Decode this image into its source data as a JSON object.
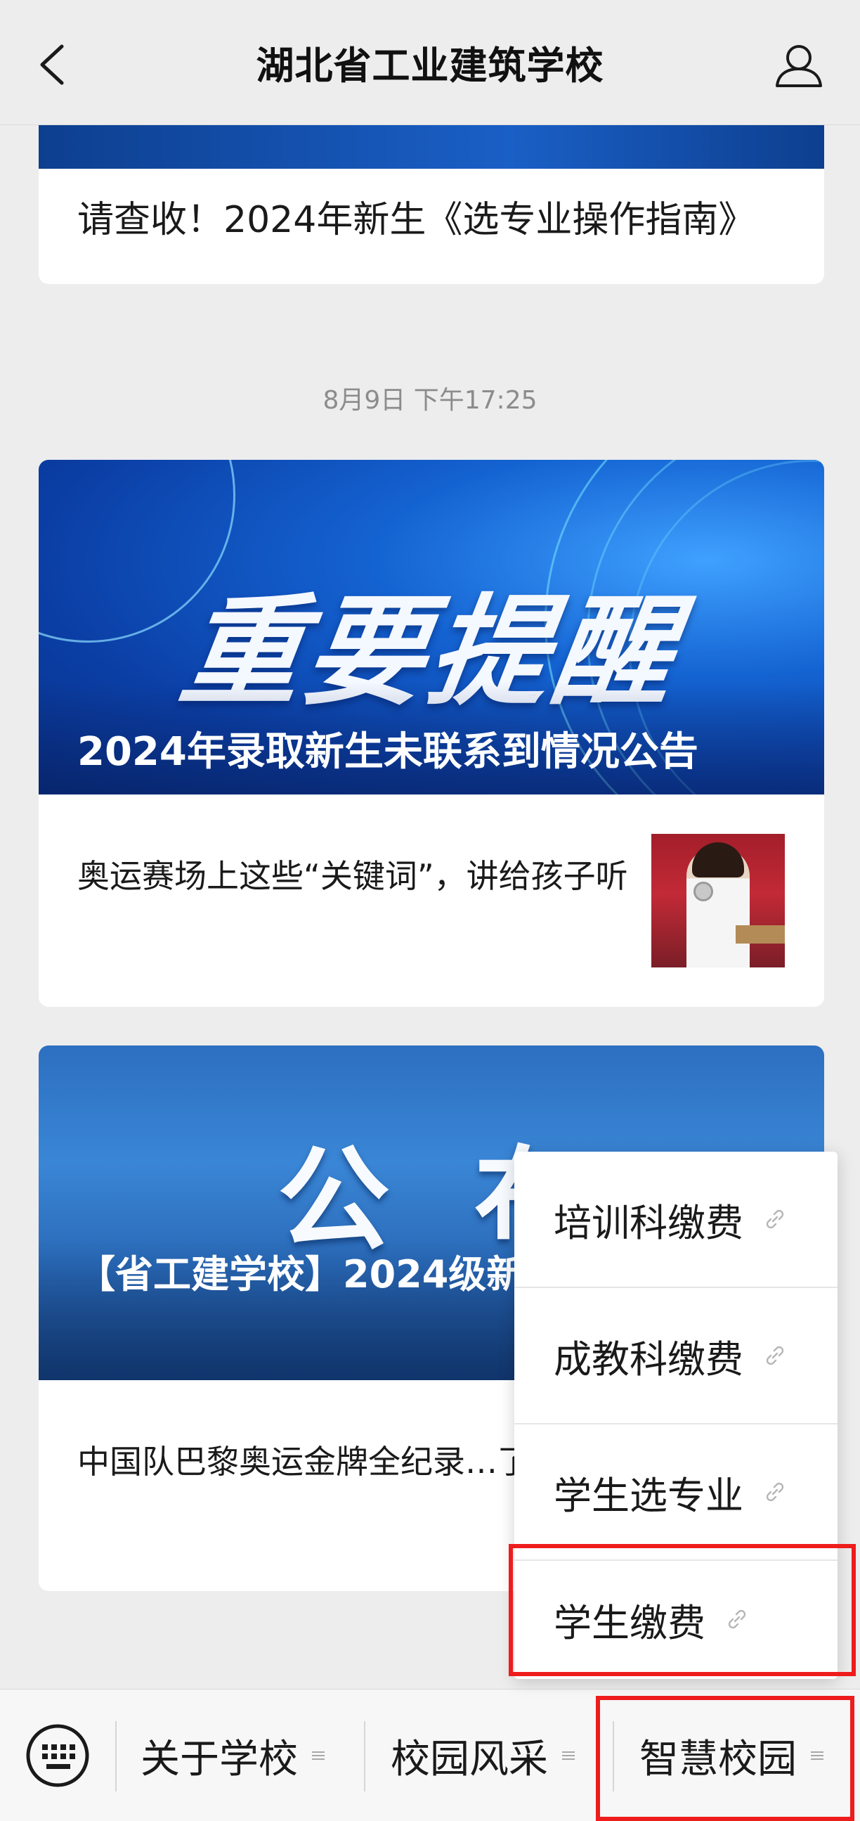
{
  "header": {
    "title": "湖北省工业建筑学校"
  },
  "feed": {
    "card1_headline": "请查收！2024年新生《选专业操作指南》",
    "timestamp": "8月9日 下午17:25",
    "card2": {
      "banner_big_text": "重要提醒",
      "banner_caption": "2024年录取新生未联系到情况公告",
      "item_text": "奥运赛场上这些“关键词”，讲给孩子听"
    },
    "card3": {
      "banner_big_text": "公布",
      "banner_caption": "【省工建学校】2024级新生…公告",
      "item_text": "中国队巴黎奥运金牌全纪录…了!"
    }
  },
  "popup_menu": {
    "items": [
      {
        "label": "培训科缴费"
      },
      {
        "label": "成教科缴费"
      },
      {
        "label": "学生选专业"
      },
      {
        "label": "学生缴费"
      }
    ]
  },
  "bottom_menu": {
    "items": [
      {
        "label": "关于学校"
      },
      {
        "label": "校园风采"
      },
      {
        "label": "智慧校园"
      }
    ]
  },
  "colors": {
    "highlight": "#ee1c1c",
    "background": "#ededed"
  }
}
